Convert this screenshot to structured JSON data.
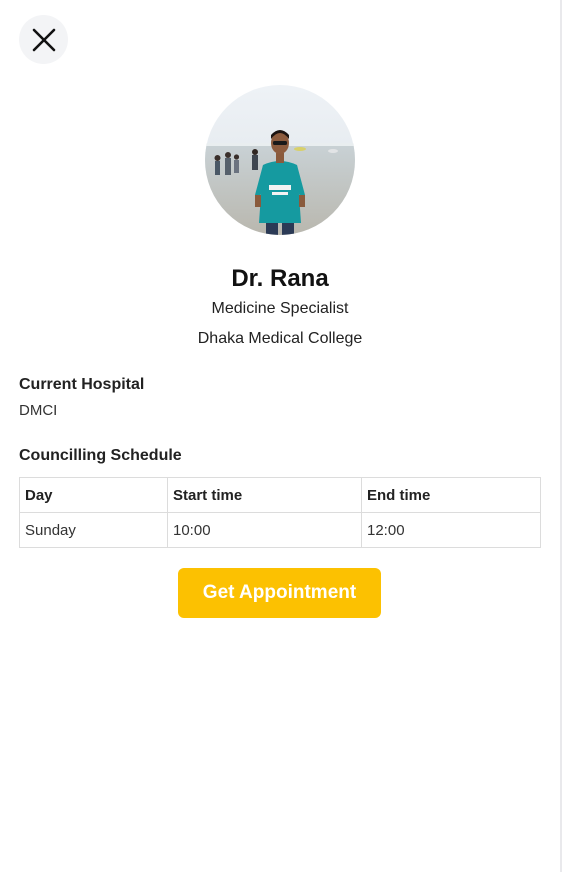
{
  "header": {
    "close_icon": "close-icon"
  },
  "doctor": {
    "name": "Dr. Rana",
    "specialty": "Medicine Specialist",
    "college": "Dhaka Medical College",
    "avatar_icon": "profile-photo"
  },
  "hospital": {
    "heading": "Current Hospital",
    "value": "DMCI"
  },
  "schedule": {
    "heading": "Councilling Schedule",
    "columns": [
      "Day",
      "Start time",
      "End time"
    ],
    "rows": [
      [
        "Sunday",
        "10:00",
        "12:00"
      ]
    ]
  },
  "actions": {
    "appointment_label": "Get Appointment",
    "appointment_color": "#fcc101"
  }
}
